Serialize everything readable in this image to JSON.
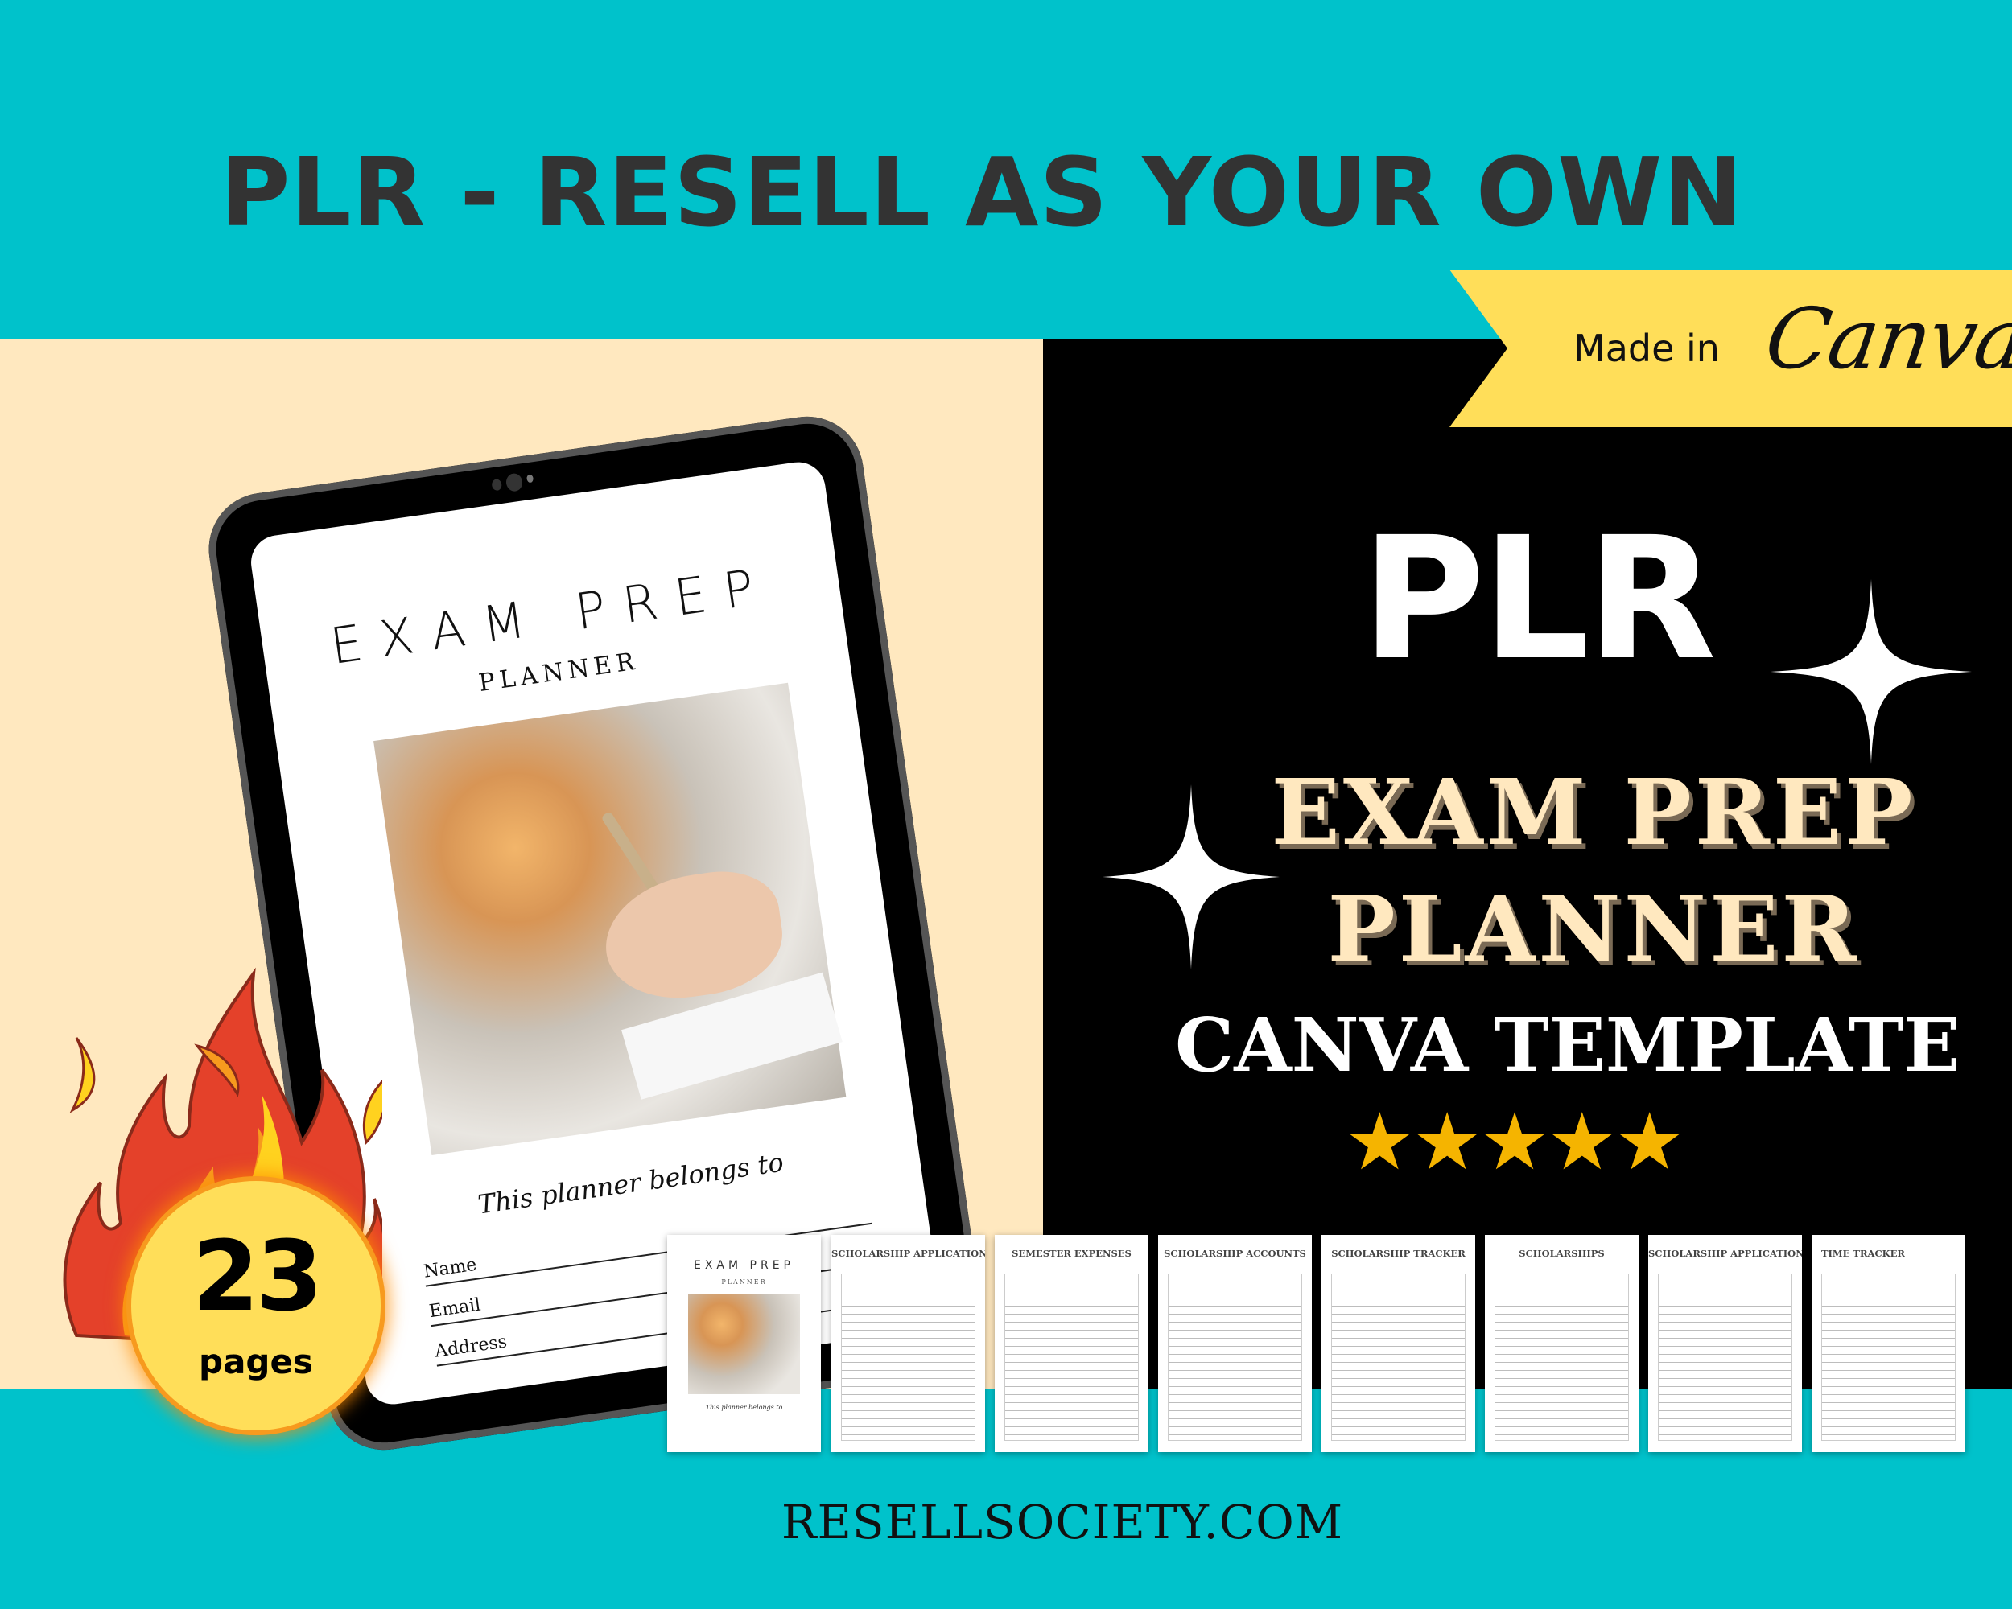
{
  "headline": "PLR - RESELL AS YOUR OWN",
  "ribbon": {
    "made_in": "Made in",
    "brand": "Canva"
  },
  "hero": {
    "plr": "PLR",
    "title_line1": "EXAM PREP",
    "title_line2": "PLANNER",
    "subtitle": "CANVA TEMPLATE",
    "rating_stars": "★★★★★",
    "rating_value": 5,
    "rating_max": 5
  },
  "tablet_screen": {
    "title": "EXAM PREP",
    "subtitle": "PLANNER",
    "belongs_to": "This planner belongs to",
    "fields": [
      "Name",
      "Email",
      "Address"
    ]
  },
  "badge": {
    "count": "23",
    "label": "pages"
  },
  "thumbnails": [
    {
      "title": "EXAM PREP",
      "subtitle": "PLANNER",
      "belongs_to": "This planner belongs to",
      "type": "cover"
    },
    {
      "title": "SCHOLARSHIP APPLICATION",
      "type": "page"
    },
    {
      "title": "SEMESTER EXPENSES",
      "type": "page"
    },
    {
      "title": "SCHOLARSHIP ACCOUNTS",
      "type": "page"
    },
    {
      "title": "SCHOLARSHIP TRACKER",
      "type": "page"
    },
    {
      "title": "SCHOLARSHIPS",
      "type": "page"
    },
    {
      "title": "SCHOLARSHIP APPLICATION",
      "type": "page"
    },
    {
      "title": "TIME TRACKER",
      "type": "page"
    }
  ],
  "footer_url": "RESELLSOCIETY.COM",
  "colors": {
    "teal": "#00C2CB",
    "cream": "#FFE8BF",
    "black": "#000000",
    "ribbon_yellow": "#FFDE59",
    "headline_dark": "#333333",
    "star_gold": "#F5B400"
  }
}
